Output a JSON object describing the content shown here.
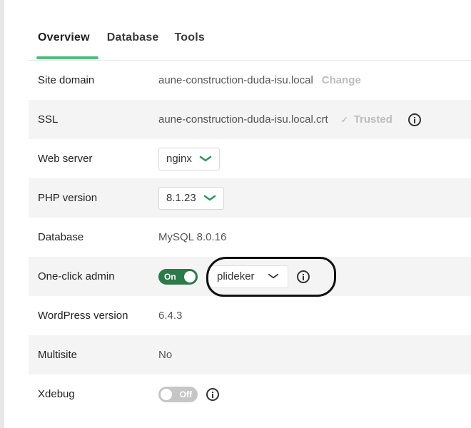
{
  "tabs": [
    {
      "label": "Overview",
      "active": true
    },
    {
      "label": "Database",
      "active": false
    },
    {
      "label": "Tools",
      "active": false
    }
  ],
  "rows": {
    "site_domain": {
      "label": "Site domain",
      "value": "aune-construction-duda-isu.local",
      "action": "Change"
    },
    "ssl": {
      "label": "SSL",
      "value": "aune-construction-duda-isu.local.crt",
      "status_check": "✓",
      "status": "Trusted",
      "status_icon": "info-icon"
    },
    "web_server": {
      "label": "Web server",
      "value": "nginx"
    },
    "php_version": {
      "label": "PHP version",
      "value": "8.1.23"
    },
    "database": {
      "label": "Database",
      "value": "MySQL 8.0.16"
    },
    "one_click_admin": {
      "label": "One-click admin",
      "toggle": "On",
      "toggle_state": true,
      "user": "plideker"
    },
    "wordpress_version": {
      "label": "WordPress version",
      "value": "6.4.3"
    },
    "multisite": {
      "label": "Multisite",
      "value": "No"
    },
    "xdebug": {
      "label": "Xdebug",
      "toggle": "Off",
      "toggle_state": false
    }
  },
  "colors": {
    "accent_green": "#51bb7b",
    "toggle_on": "#2c7a4a",
    "toggle_off": "#c6c6c6",
    "row_alt": "#f4f4f4",
    "muted": "#bdbdbd"
  }
}
